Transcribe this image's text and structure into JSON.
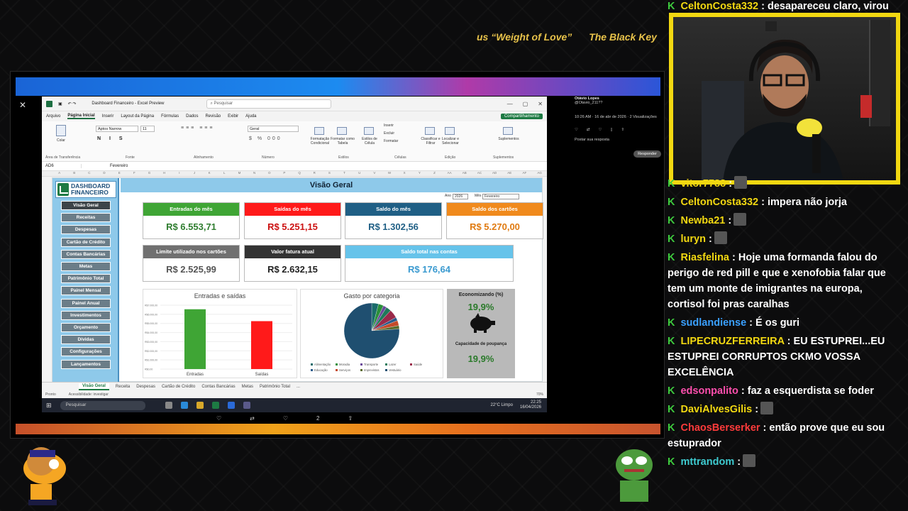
{
  "stream": {
    "now_playing": [
      "us “Weight of Love”",
      "The Black Key"
    ]
  },
  "excel": {
    "title": "Dashboard Financeiro - Excel Preview",
    "search_placeholder": "Pesquisar",
    "menu": [
      "Arquivo",
      "Página Inicial",
      "Inserir",
      "Layout da Página",
      "Fórmulas",
      "Dados",
      "Revisão",
      "Exibir",
      "Ajuda"
    ],
    "share": "Compartilhamento",
    "ribbon": {
      "paste": "Colar",
      "font": "Aptos Narrow",
      "size": "11",
      "number_format": "Geral",
      "groups": [
        "Área de Transferência",
        "Fonte",
        "Alinhamento",
        "Número",
        "Estilos",
        "Células",
        "Edição",
        "Suplementos"
      ],
      "buttons": [
        "Formatação Condicional",
        "Formatar como Tabela",
        "Estilos de Célula",
        "Inserir",
        "Excluir",
        "Formatar",
        "Classificar e Filtrar",
        "Localizar e Selecionar",
        "Suplementos"
      ]
    },
    "name_box": "AD6",
    "formula": "Fevereiro",
    "columns": [
      "A",
      "B",
      "C",
      "D",
      "E",
      "F",
      "G",
      "H",
      "I",
      "J",
      "K",
      "L",
      "M",
      "N",
      "O",
      "P",
      "Q",
      "R",
      "S",
      "T",
      "U",
      "V",
      "W",
      "X",
      "Y",
      "Z",
      "AA",
      "AB",
      "AC",
      "AD",
      "AE",
      "AF",
      "AG"
    ],
    "sheet_tabs": [
      "Visão Geral",
      "Receita",
      "Despesas",
      "Cartão de Crédito",
      "Contas Bancárias",
      "Metas",
      "Patrimônio Total",
      "..."
    ],
    "status": [
      "Pronto",
      "Acessibilidade: investigar"
    ],
    "zoom": "70%"
  },
  "dashboard": {
    "logo": [
      "DASHBOARD",
      "FINANCEIRO"
    ],
    "title": "Visão Geral",
    "year_label": "Ano",
    "year": "2026",
    "month_label": "Mês",
    "month": "Fevereiro",
    "nav": [
      "Visão Geral",
      "Receitas",
      "Despesas",
      "Cartão de Crédito",
      "Contas Bancárias",
      "Metas",
      "Patrimônio Total",
      "Painel Mensal",
      "Painel Anual",
      "Investimentos",
      "Orçamento",
      "Dívidas",
      "Configurações",
      "Lançamentos"
    ],
    "cards": [
      {
        "label": "Entradas do mês",
        "value": "R$ 6.553,71",
        "color": "#3fa535",
        "vcolor": "#2f7d2f"
      },
      {
        "label": "Saídas do mês",
        "value": "R$ 5.251,15",
        "color": "#ff1a1a",
        "vcolor": "#cc1111"
      },
      {
        "label": "Saldo do mês",
        "value": "R$ 1.302,56",
        "color": "#1f5f85",
        "vcolor": "#1f5f85"
      },
      {
        "label": "Saldo dos cartões",
        "value": "R$ 5.270,00",
        "color": "#f08a1c",
        "vcolor": "#e07a10"
      },
      {
        "label": "Limite utilizado nos cartões",
        "value": "R$ 2.525,99",
        "color": "#707070",
        "vcolor": "#555"
      },
      {
        "label": "Valor fatura atual",
        "value": "R$ 2.632,15",
        "color": "#333",
        "vcolor": "#222"
      },
      {
        "label": "Saldo total nas contas",
        "value": "R$ 176,64",
        "color": "#66c3ea",
        "vcolor": "#3a9ad0"
      }
    ],
    "economia": {
      "title": "Economizando (%)",
      "value": "19,9%",
      "sub": "Capacidade de poupança",
      "value2": "19,9%"
    }
  },
  "chart_data": [
    {
      "type": "bar",
      "title": "Entradas e saídas",
      "categories": [
        "Entradas",
        "Saídas"
      ],
      "values": [
        6553.71,
        5251.15
      ],
      "colors": [
        "#3fa535",
        "#ff1a1a"
      ],
      "ylim": [
        0,
        7000
      ],
      "yticks": [
        "R$0,00",
        "R$1.000,00",
        "R$2.000,00",
        "R$3.000,00",
        "R$4.000,00",
        "R$5.000,00",
        "R$6.000,00",
        "R$7.000,00"
      ]
    },
    {
      "type": "pie",
      "title": "Gasto por categoria",
      "legend": [
        "Alimentação",
        "Moradia",
        "Transporte",
        "Lazer",
        "Saúde",
        "Educação",
        "Serviços",
        "Imprevistos",
        "Vestuário"
      ],
      "values": [
        4,
        3,
        2,
        3,
        5,
        2,
        3,
        2,
        76
      ],
      "colors": [
        "#1a6b6b",
        "#2a8f3a",
        "#6a4a9a",
        "#1f7a5a",
        "#9a2a4a",
        "#2a5a8a",
        "#c44a2a",
        "#5a6a2a",
        "#1f4f70"
      ]
    }
  ],
  "twitter": {
    "name": "Otávio Lopes",
    "handle": "@Otavio_211??",
    "time": "10:26 AM · 16 de abr de 2026 · 2 Visualizações",
    "reply_placeholder": "Postar sua resposta",
    "reply_btn": "Responder"
  },
  "taskbar": {
    "search": "Pesquisar",
    "weather": "22°C  Limpo",
    "time": "22:25",
    "date": "16/04/2026"
  },
  "xbar": [
    "♡",
    "⇄",
    "♡",
    "2",
    "⇧"
  ],
  "chat": [
    {
      "user": "CeltonCosta332",
      "color": "#f2d811",
      "text": " : desapareceu claro, virou"
    },
    {
      "user": "vitor7788",
      "color": "#f2d811",
      "text": " :"
    },
    {
      "user": "CeltonCosta332",
      "color": "#f2d811",
      "text": " : impera não jorja"
    },
    {
      "user": "Newba21",
      "color": "#f2d811",
      "text": " :"
    },
    {
      "user": "luryn",
      "color": "#f2d811",
      "text": " :"
    },
    {
      "user": "Riasfelina",
      "color": "#f2d811",
      "text": " : Hoje uma formanda falou do perigo de red pill e que e xenofobia falar que tem um monte de imigrantes na europa, cortisol foi pras caralhas"
    },
    {
      "user": "sudlandiense",
      "color": "#3aa0ff",
      "text": " : É os guri"
    },
    {
      "user": "LIPECRUZFERREIRA",
      "color": "#f2d811",
      "text": " : EU ESTUPREI...EU ESTUPREI CORRUPTOS CKMO VOSSA EXCELÊNCIA"
    },
    {
      "user": "edsonpalito",
      "color": "#ff4fae",
      "text": " : faz a esquerdista se foder"
    },
    {
      "user": "DaviAlvesGilis",
      "color": "#f2d811",
      "text": " :"
    },
    {
      "user": "ChaosBerserker",
      "color": "#ff3b3b",
      "text": " : então prove que eu sou estuprador"
    },
    {
      "user": "mttrandom",
      "color": "#3ecbd0",
      "text": " :"
    }
  ]
}
